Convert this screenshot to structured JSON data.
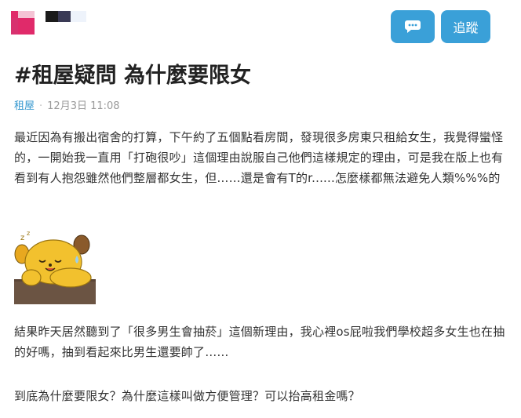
{
  "header": {
    "chat_icon": "chat-bubble-icon",
    "follow_label": "追蹤"
  },
  "post": {
    "title": "#租屋疑問 為什麼要限女",
    "board": "租屋",
    "separator": "·",
    "date": "12月3日 11:08",
    "paragraphs": [
      "最近因為有搬出宿舍的打算，下午約了五個點看房間，發現很多房東只租給女生，我覺得蠻怪的，一開始我一直用「打砲很吵」這個理由說服自己他們這樣規定的理由，可是我在版上也有看到有人抱怨雖然他們整層都女生，但……還是會有T的r......怎麼樣都無法避免人類%%%的",
      "結果昨天居然聽到了「很多男生會抽菸」這個新理由，我心裡os屁啦我們學校超多女生也在抽的好嗎，抽到看起來比男生還要帥了……",
      "到底為什麼要限女？為什麼這樣叫做方便管理？可以抬高租金嗎？"
    ]
  },
  "colors": {
    "accent": "#3aa0d8",
    "board_link": "#3397cf",
    "avatar": "#e02a6a",
    "sticker_body": "#f2c12e",
    "sticker_ground": "#6b5443"
  }
}
